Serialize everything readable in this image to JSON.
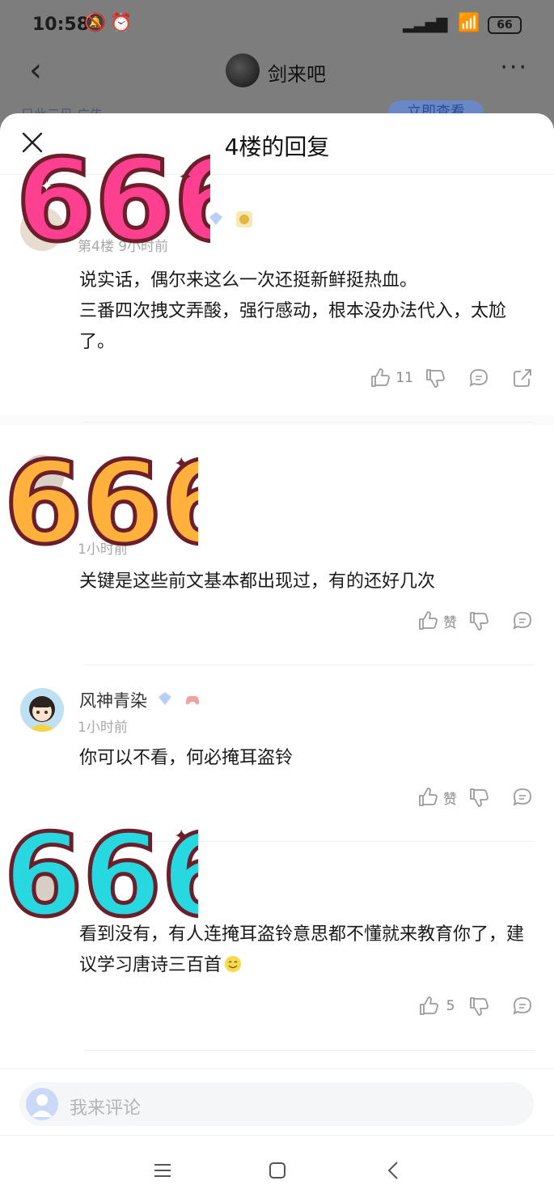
{
  "status_bar": {
    "time": "10:58",
    "battery": "66"
  },
  "top_nav": {
    "forum_name": "剑来吧",
    "more": "···"
  },
  "ad": {
    "text": "只此三见 广告",
    "button": "立即查看"
  },
  "sheet": {
    "title": "4楼的回复",
    "replies": [
      {
        "username": "",
        "meta": "第4楼 9小时前",
        "body": "说实话，偶尔来这么一次还挺新鲜挺热血。\n三番四次拽文弄酸，强行感动，根本没办法代入，太尬了。",
        "like_count": "11",
        "sticker": "666"
      },
      {
        "username": "",
        "meta": "1小时前",
        "body": "关键是这些前文基本都出现过，有的还好几次",
        "like_count": "赞",
        "sticker": "666"
      },
      {
        "username": "风神青染",
        "meta": "1小时前",
        "body": "你可以不看，何必掩耳盗铃",
        "like_count": "赞"
      },
      {
        "username": "",
        "meta": "",
        "body": "看到没有，有人连掩耳盗铃意思都不懂就来教育你了，建议学习唐诗三百首",
        "like_count": "5",
        "sticker": "666"
      }
    ]
  },
  "input": {
    "placeholder": "我来评论"
  },
  "colors": {
    "accent": "#3a6ee8",
    "like_icon": "#9a9a9a",
    "level_badge": "#8fb3f2"
  },
  "icons": [
    "back-icon",
    "more-icon",
    "close-icon",
    "thumb-up-icon",
    "thumb-down-icon",
    "comment-icon",
    "share-icon",
    "menu-icon",
    "home-icon",
    "back-nav-icon"
  ]
}
